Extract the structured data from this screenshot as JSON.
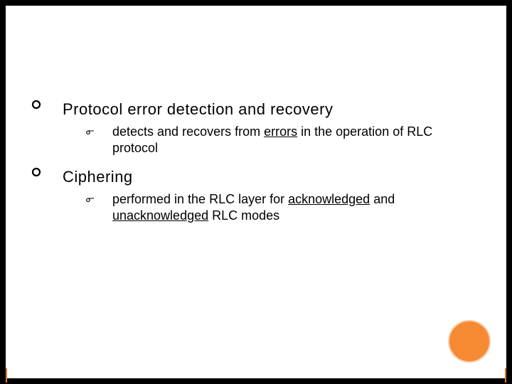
{
  "bullets": [
    {
      "title": "Protocol error detection and recovery",
      "sub": {
        "pre": "detects and recovers from ",
        "u1": "errors",
        "post": " in the operation of RLC protocol"
      }
    },
    {
      "title": "Ciphering",
      "sub": {
        "pre": "performed in the RLC layer for ",
        "u1": "acknowledged",
        "mid": " and ",
        "u2": "unacknowledged",
        "post": " RLC modes"
      }
    }
  ],
  "glyphs": {
    "swirl": "൳"
  },
  "colors": {
    "accent": "#f58a33"
  }
}
